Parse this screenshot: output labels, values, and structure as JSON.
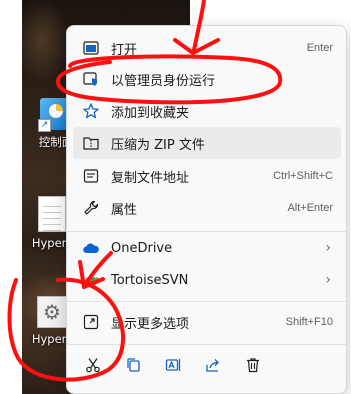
{
  "desktop": {
    "icons": [
      {
        "label": "控制面",
        "icon": "control-panel-icon"
      },
      {
        "label": "Hyper_",
        "icon": "document-icon"
      },
      {
        "label": "Hyper_",
        "icon": "settings-document-icon"
      }
    ]
  },
  "context_menu": {
    "items": [
      {
        "label": "打开",
        "shortcut": "Enter",
        "icon": "open-icon"
      },
      {
        "label": "以管理员身份运行",
        "shortcut": "",
        "icon": "shield-admin-icon"
      },
      {
        "label": "添加到收藏夹",
        "shortcut": "",
        "icon": "star-icon"
      },
      {
        "label": "压缩为 ZIP 文件",
        "shortcut": "",
        "icon": "zip-folder-icon"
      },
      {
        "label": "复制文件地址",
        "shortcut": "Ctrl+Shift+C",
        "icon": "copy-path-icon"
      },
      {
        "label": "属性",
        "shortcut": "Alt+Enter",
        "icon": "wrench-icon"
      },
      {
        "label": "OneDrive",
        "shortcut": "",
        "icon": "cloud-icon",
        "submenu": "›"
      },
      {
        "label": "TortoiseSVN",
        "shortcut": "",
        "icon": "tortoise-icon",
        "submenu": "›"
      },
      {
        "label": "显示更多选项",
        "shortcut": "Shift+F10",
        "icon": "expand-icon"
      }
    ],
    "bottom_actions": [
      {
        "icon": "cut-icon"
      },
      {
        "icon": "copy-icon"
      },
      {
        "icon": "rename-icon"
      },
      {
        "icon": "share-icon"
      },
      {
        "icon": "delete-icon"
      }
    ],
    "accent_color": "#0067c0",
    "hover_bg": "#ebebeb"
  },
  "annotation": {
    "color": "#ff1010"
  }
}
